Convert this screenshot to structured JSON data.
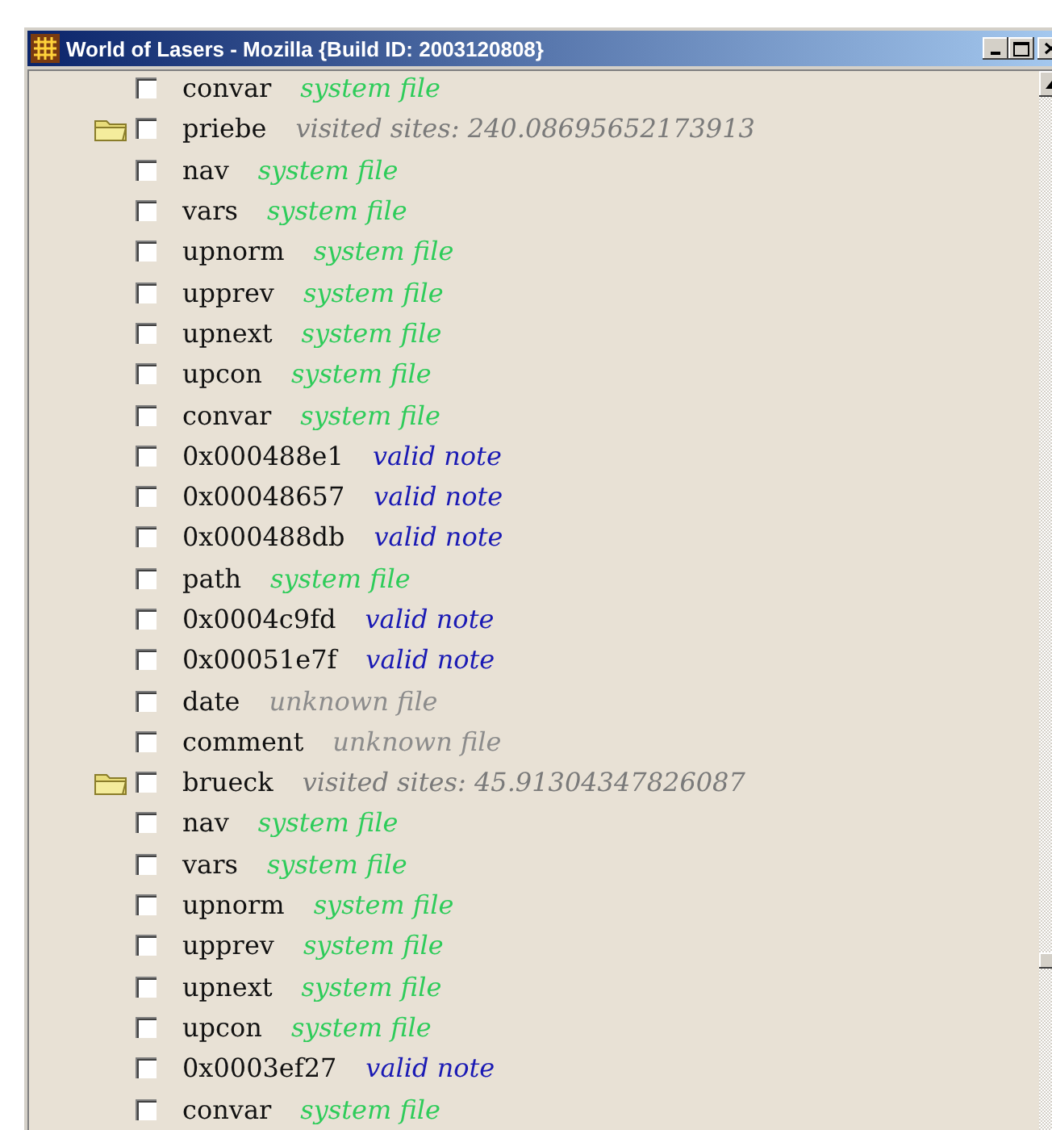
{
  "window": {
    "title": "World of Lasers - Mozilla {Build ID: 2003120808}"
  },
  "rows": [
    {
      "kind": "file",
      "name": "convar",
      "detail": "system file",
      "color": "#2ecc5a",
      "checked": false
    },
    {
      "kind": "folder",
      "name": "priebe",
      "detail": "visited sites: 240.08695652173913",
      "color": "#7a7a7a",
      "checked": false
    },
    {
      "kind": "file",
      "name": "nav",
      "detail": "system file",
      "color": "#2ecc5a",
      "checked": false
    },
    {
      "kind": "file",
      "name": "vars",
      "detail": "system file",
      "color": "#2ecc5a",
      "checked": false
    },
    {
      "kind": "file",
      "name": "upnorm",
      "detail": "system file",
      "color": "#2ecc5a",
      "checked": false
    },
    {
      "kind": "file",
      "name": "upprev",
      "detail": "system file",
      "color": "#2ecc5a",
      "checked": false
    },
    {
      "kind": "file",
      "name": "upnext",
      "detail": "system file",
      "color": "#2ecc5a",
      "checked": false
    },
    {
      "kind": "file",
      "name": "upcon",
      "detail": "system file",
      "color": "#2ecc5a",
      "checked": false
    },
    {
      "kind": "file",
      "name": "convar",
      "detail": "system file",
      "color": "#2ecc5a",
      "checked": false
    },
    {
      "kind": "file",
      "name": "0x000488e1",
      "detail": "valid note",
      "color": "#1a1ab4",
      "checked": false
    },
    {
      "kind": "file",
      "name": "0x00048657",
      "detail": "valid note",
      "color": "#1a1ab4",
      "checked": false
    },
    {
      "kind": "file",
      "name": "0x000488db",
      "detail": "valid note",
      "color": "#1a1ab4",
      "checked": false
    },
    {
      "kind": "file",
      "name": "path",
      "detail": "system file",
      "color": "#2ecc5a",
      "checked": false
    },
    {
      "kind": "file",
      "name": "0x0004c9fd",
      "detail": "valid note",
      "color": "#1a1ab4",
      "checked": false
    },
    {
      "kind": "file",
      "name": "0x00051e7f",
      "detail": "valid note",
      "color": "#1a1ab4",
      "checked": false
    },
    {
      "kind": "file",
      "name": "date",
      "detail": "unknown file",
      "color": "#8c8c8c",
      "checked": false
    },
    {
      "kind": "file",
      "name": "comment",
      "detail": "unknown file",
      "color": "#8c8c8c",
      "checked": false
    },
    {
      "kind": "folder",
      "name": "brueck",
      "detail": "visited sites: 45.91304347826087",
      "color": "#7a7a7a",
      "checked": false
    },
    {
      "kind": "file",
      "name": "nav",
      "detail": "system file",
      "color": "#2ecc5a",
      "checked": false
    },
    {
      "kind": "file",
      "name": "vars",
      "detail": "system file",
      "color": "#2ecc5a",
      "checked": false
    },
    {
      "kind": "file",
      "name": "upnorm",
      "detail": "system file",
      "color": "#2ecc5a",
      "checked": false
    },
    {
      "kind": "file",
      "name": "upprev",
      "detail": "system file",
      "color": "#2ecc5a",
      "checked": false
    },
    {
      "kind": "file",
      "name": "upnext",
      "detail": "system file",
      "color": "#2ecc5a",
      "checked": false
    },
    {
      "kind": "file",
      "name": "upcon",
      "detail": "system file",
      "color": "#2ecc5a",
      "checked": false
    },
    {
      "kind": "file",
      "name": "0x0003ef27",
      "detail": "valid note",
      "color": "#1a1ab4",
      "checked": false
    },
    {
      "kind": "file",
      "name": "convar",
      "detail": "system file",
      "color": "#2ecc5a",
      "checked": false
    }
  ]
}
